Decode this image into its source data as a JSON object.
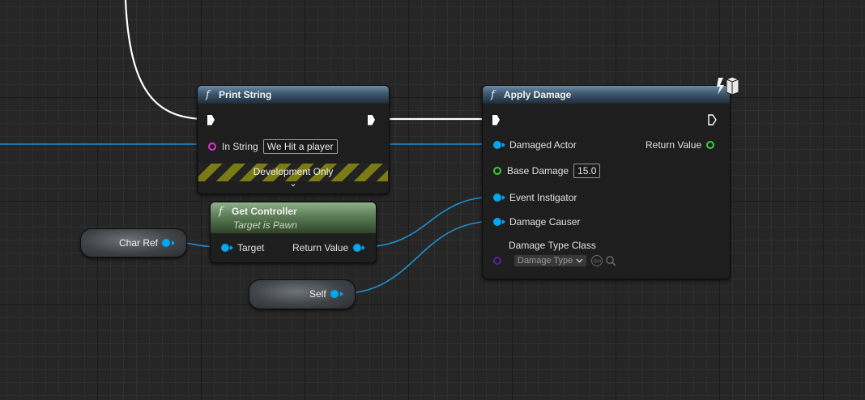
{
  "nodes": {
    "print_string": {
      "title": "Print String",
      "in_string_label": "In String",
      "in_string_value": "We Hit a player",
      "dev_only_label": "Development Only",
      "expand_glyph": "⌄"
    },
    "apply_damage": {
      "title": "Apply Damage",
      "damaged_actor_label": "Damaged Actor",
      "return_value_label": "Return Value",
      "base_damage_label": "Base Damage",
      "base_damage_value": "15.0",
      "event_instigator_label": "Event Instigator",
      "damage_causer_label": "Damage Causer",
      "damage_type_class_label": "Damage Type Class",
      "damage_type_dropdown": "Damage Type",
      "authority_icon": "server-cube-icon"
    },
    "get_controller": {
      "title": "Get Controller",
      "subtitle": "Target is Pawn",
      "target_label": "Target",
      "return_value_label": "Return Value"
    },
    "char_ref": {
      "label": "Char Ref"
    },
    "self_ref": {
      "label": "Self"
    }
  },
  "icons": {
    "function": "f",
    "browse": "⇦",
    "search": "search-icon"
  },
  "colors": {
    "background": "#262626",
    "exec_wire": "#ffffff",
    "object_pin": "#00a8f0",
    "string_pin": "#e033d2",
    "float_pin": "#38d038",
    "class_pin": "#5a1ea8",
    "function_header": "#3f5c74",
    "pure_header": "#5b7d56",
    "hazard_yellow": "#7a7b15"
  }
}
